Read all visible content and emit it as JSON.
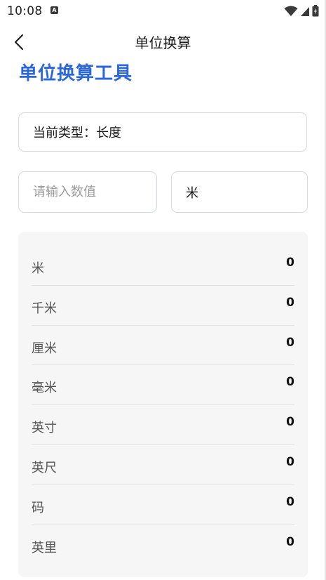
{
  "status_bar": {
    "time": "10:08",
    "notification_icon": "a-icon",
    "icons": [
      "wifi-icon",
      "signal-icon",
      "battery-icon"
    ]
  },
  "app_bar": {
    "back_icon": "chevron-left-icon",
    "title": "单位换算"
  },
  "page_heading": "单位换算工具",
  "type_card": {
    "label": "当前类型：长度"
  },
  "input": {
    "value": "",
    "placeholder": "请输入数值"
  },
  "unit_select": {
    "selected": "米"
  },
  "results": [
    {
      "unit": "米",
      "value": "0"
    },
    {
      "unit": "千米",
      "value": "0"
    },
    {
      "unit": "厘米",
      "value": "0"
    },
    {
      "unit": "毫米",
      "value": "0"
    },
    {
      "unit": "英寸",
      "value": "0"
    },
    {
      "unit": "英尺",
      "value": "0"
    },
    {
      "unit": "码",
      "value": "0"
    },
    {
      "unit": "英里",
      "value": "0"
    }
  ],
  "colors": {
    "accent": "#2b67d6",
    "panel_bg": "#f6f6f6",
    "border": "#d6d9de"
  }
}
